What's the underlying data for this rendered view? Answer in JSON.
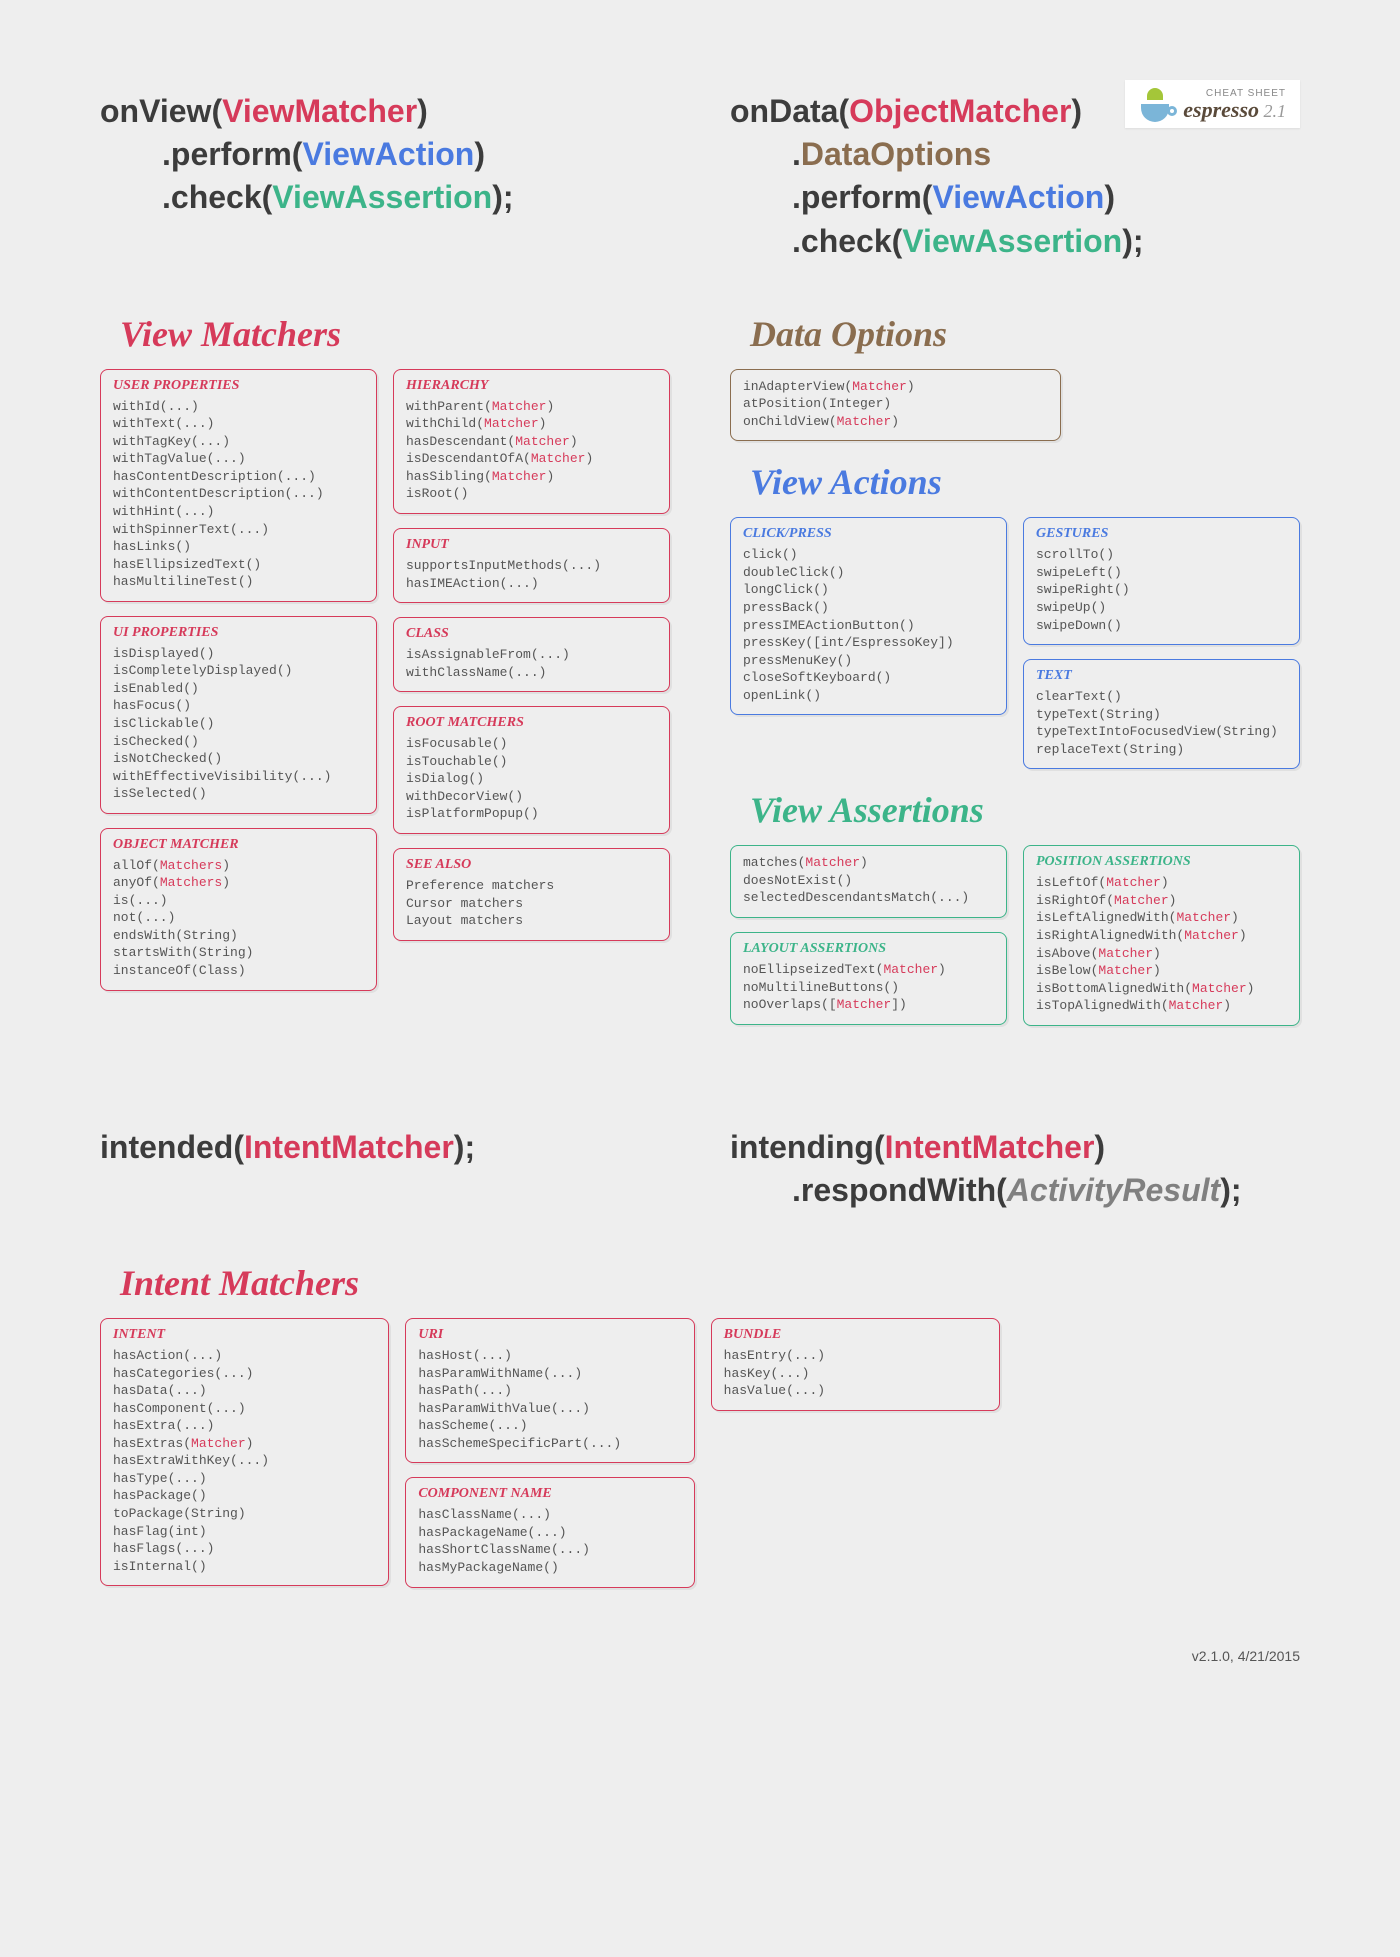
{
  "logo": {
    "cheat": "CHEAT SHEET",
    "name": "espresso",
    "version": "2.1"
  },
  "footer": "v2.1.0, 4/21/2015",
  "sig_onview": {
    "l1_pre": "onView(",
    "l1_arg": "ViewMatcher",
    "l1_post": ")",
    "l2_pre": ".perform(",
    "l2_arg": "ViewAction",
    "l2_post": ")",
    "l3_pre": ".check(",
    "l3_arg": "ViewAssertion",
    "l3_post": ");"
  },
  "sig_ondata": {
    "l1_pre": "onData(",
    "l1_arg": "ObjectMatcher",
    "l1_post": ")",
    "l2_pre": ".",
    "l2_arg": "DataOptions",
    "l3_pre": ".perform(",
    "l3_arg": "ViewAction",
    "l3_post": ")",
    "l4_pre": ".check(",
    "l4_arg": "ViewAssertion",
    "l4_post": ");"
  },
  "sig_intended": {
    "l1_pre": "intended(",
    "l1_arg": "IntentMatcher",
    "l1_post": ");"
  },
  "sig_intending": {
    "l1_pre": "intending(",
    "l1_arg": "IntentMatcher",
    "l1_post": ")",
    "l2_pre": ".respondWith(",
    "l2_arg": "ActivityResult",
    "l2_post": ");"
  },
  "sections": {
    "view_matchers": "View Matchers",
    "data_options": "Data Options",
    "view_actions": "View Actions",
    "view_assertions": "View Assertions",
    "intent_matchers": "Intent Matchers"
  },
  "vm_user_props": {
    "title": "USER PROPERTIES",
    "items": [
      "withId(...)",
      "withText(...)",
      "withTagKey(...)",
      "withTagValue(...)",
      "hasContentDescription(...)",
      "withContentDescription(...)",
      "withHint(...)",
      "withSpinnerText(...)",
      "hasLinks()",
      "hasEllipsizedText()",
      "hasMultilineTest()"
    ]
  },
  "vm_ui_props": {
    "title": "UI PROPERTIES",
    "items": [
      "isDisplayed()",
      "isCompletelyDisplayed()",
      "isEnabled()",
      "hasFocus()",
      "isClickable()",
      "isChecked()",
      "isNotChecked()",
      "withEffectiveVisibility(...)",
      "isSelected()"
    ]
  },
  "vm_object": {
    "title": "OBJECT MATCHER",
    "items": [
      {
        "pre": "allOf(",
        "arg": "Matchers",
        "post": ")"
      },
      {
        "pre": "anyOf(",
        "arg": "Matchers",
        "post": ")"
      },
      "is(...)",
      "not(...)",
      "endsWith(String)",
      "startsWith(String)",
      "instanceOf(Class)"
    ]
  },
  "vm_hierarchy": {
    "title": "HIERARCHY",
    "items": [
      {
        "pre": "withParent(",
        "arg": "Matcher",
        "post": ")"
      },
      {
        "pre": "withChild(",
        "arg": "Matcher",
        "post": ")"
      },
      {
        "pre": "hasDescendant(",
        "arg": "Matcher",
        "post": ")"
      },
      {
        "pre": "isDescendantOfA(",
        "arg": "Matcher",
        "post": ")"
      },
      {
        "pre": "hasSibling(",
        "arg": "Matcher",
        "post": ")"
      },
      "isRoot()"
    ]
  },
  "vm_input": {
    "title": "INPUT",
    "items": [
      "supportsInputMethods(...)",
      "hasIMEAction(...)"
    ]
  },
  "vm_class": {
    "title": "CLASS",
    "items": [
      "isAssignableFrom(...)",
      "withClassName(...)"
    ]
  },
  "vm_root": {
    "title": "ROOT MATCHERS",
    "items": [
      "isFocusable()",
      "isTouchable()",
      "isDialog()",
      "withDecorView()",
      "isPlatformPopup()"
    ]
  },
  "vm_seealso": {
    "title": "SEE ALSO",
    "items": [
      "Preference matchers",
      "Cursor matchers",
      "Layout matchers"
    ]
  },
  "data_opts": {
    "items": [
      {
        "pre": "inAdapterView(",
        "arg": "Matcher",
        "post": ")"
      },
      "atPosition(Integer)",
      {
        "pre": "onChildView(",
        "arg": "Matcher",
        "post": ")"
      }
    ]
  },
  "va_click": {
    "title": "CLICK/PRESS",
    "items": [
      "click()",
      "doubleClick()",
      "longClick()",
      "pressBack()",
      "pressIMEActionButton()",
      "pressKey([int/EspressoKey])",
      "pressMenuKey()",
      "closeSoftKeyboard()",
      "openLink()"
    ]
  },
  "va_gestures": {
    "title": "GESTURES",
    "items": [
      "scrollTo()",
      "swipeLeft()",
      "swipeRight()",
      "swipeUp()",
      "swipeDown()"
    ]
  },
  "va_text": {
    "title": "TEXT",
    "items": [
      "clearText()",
      "typeText(String)",
      "typeTextIntoFocusedView(String)",
      "replaceText(String)"
    ]
  },
  "vassert_main": {
    "items": [
      {
        "pre": "matches(",
        "arg": "Matcher",
        "post": ")"
      },
      "doesNotExist()",
      "selectedDescendantsMatch(...)"
    ]
  },
  "vassert_layout": {
    "title": "LAYOUT ASSERTIONS",
    "items": [
      {
        "pre": "noEllipseizedText(",
        "arg": "Matcher",
        "post": ")"
      },
      "noMultilineButtons()",
      {
        "pre": "noOverlaps([",
        "arg": "Matcher",
        "post": "])"
      }
    ]
  },
  "vassert_pos": {
    "title": "POSITION ASSERTIONS",
    "items": [
      {
        "pre": "isLeftOf(",
        "arg": "Matcher",
        "post": ")"
      },
      {
        "pre": "isRightOf(",
        "arg": "Matcher",
        "post": ")"
      },
      {
        "pre": "isLeftAlignedWith(",
        "arg": "Matcher",
        "post": ")"
      },
      {
        "pre": "isRightAlignedWith(",
        "arg": "Matcher",
        "post": ")"
      },
      {
        "pre": "isAbove(",
        "arg": "Matcher",
        "post": ")"
      },
      {
        "pre": "isBelow(",
        "arg": "Matcher",
        "post": ")"
      },
      {
        "pre": "isBottomAlignedWith(",
        "arg": "Matcher",
        "post": ")"
      },
      {
        "pre": "isTopAlignedWith(",
        "arg": "Matcher",
        "post": ")"
      }
    ]
  },
  "im_intent": {
    "title": "INTENT",
    "items": [
      "hasAction(...)",
      "hasCategories(...)",
      "hasData(...)",
      "hasComponent(...)",
      "hasExtra(...)",
      {
        "pre": "hasExtras(",
        "arg": "Matcher",
        "post": ")"
      },
      "hasExtraWithKey(...)",
      "hasType(...)",
      "hasPackage()",
      "toPackage(String)",
      "hasFlag(int)",
      "hasFlags(...)",
      "isInternal()"
    ]
  },
  "im_uri": {
    "title": "URI",
    "items": [
      "hasHost(...)",
      "hasParamWithName(...)",
      "hasPath(...)",
      "hasParamWithValue(...)",
      "hasScheme(...)",
      "hasSchemeSpecificPart(...)"
    ]
  },
  "im_comp": {
    "title": "COMPONENT NAME",
    "items": [
      "hasClassName(...)",
      "hasPackageName(...)",
      "hasShortClassName(...)",
      "hasMyPackageName()"
    ]
  },
  "im_bundle": {
    "title": "BUNDLE",
    "items": [
      "hasEntry(...)",
      "hasKey(...)",
      "hasValue(...)"
    ]
  }
}
